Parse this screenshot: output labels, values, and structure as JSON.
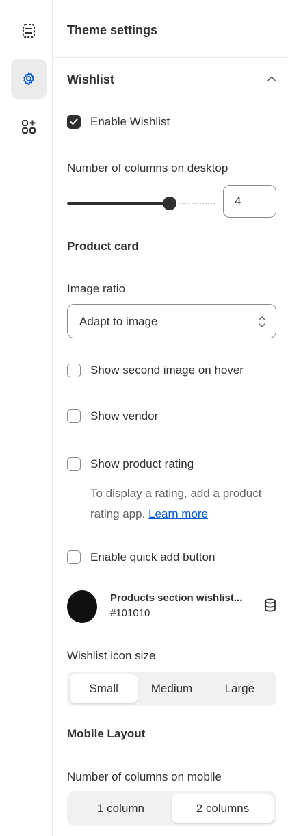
{
  "header": {
    "title": "Theme settings"
  },
  "section": {
    "title": "Wishlist"
  },
  "enable_wishlist": {
    "label": "Enable Wishlist",
    "checked": true
  },
  "desktop_columns": {
    "label": "Number of columns on desktop",
    "value": "4",
    "slider_fraction": 0.65
  },
  "product_card": {
    "title": "Product card"
  },
  "image_ratio": {
    "label": "Image ratio",
    "value": "Adapt to image"
  },
  "checkboxes": {
    "second_image": "Show second image on hover",
    "vendor": "Show vendor",
    "rating": "Show product rating",
    "quick_add": "Enable quick add button"
  },
  "rating_help": {
    "text": "To display a rating, add a product rating app.",
    "link": "Learn more"
  },
  "color": {
    "name": "Products section wishlist...",
    "hex": "#101010"
  },
  "icon_size": {
    "label": "Wishlist icon size",
    "options": [
      "Small",
      "Medium",
      "Large"
    ],
    "selected": "Small"
  },
  "mobile_layout": {
    "title": "Mobile Layout"
  },
  "mobile_columns": {
    "label": "Number of columns on mobile",
    "options": [
      "1 column",
      "2 columns"
    ],
    "selected": "2 columns"
  },
  "icons": {
    "rail_top": "sections-icon",
    "rail_active": "gear-icon",
    "rail_apps": "apps-add-icon",
    "collapse": "chevron-up-icon",
    "select": "select-arrows-icon",
    "source": "database-icon"
  },
  "colors": {
    "accent_link": "#005bd3",
    "swatch": "#101010",
    "text": "#303030"
  }
}
